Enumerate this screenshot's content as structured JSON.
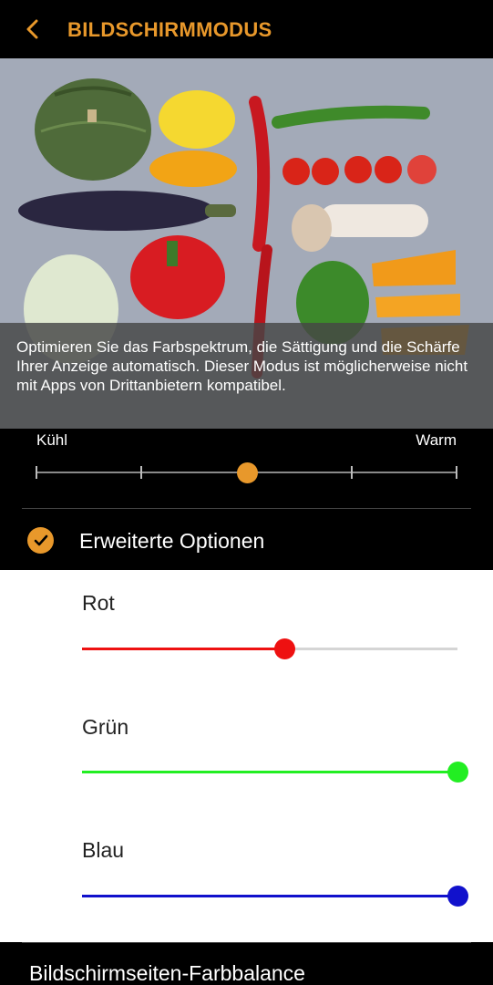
{
  "header": {
    "title": "BILDSCHIRMMODUS",
    "back_icon": "chevron-left-icon",
    "accent_color": "#e8982b"
  },
  "preview": {
    "caption": "Optimieren Sie das Farbspektrum, die Sättigung und die Schärfe Ihrer Anzeige automatisch. Dieser Modus ist möglicherweise nicht mit Apps von Drittanbietern kompatibel."
  },
  "color_temperature": {
    "left_label": "Kühl",
    "right_label": "Warm",
    "steps": 5,
    "value_step": 2
  },
  "advanced": {
    "label": "Erweiterte Optionen",
    "checked": true
  },
  "rgb": [
    {
      "label": "Rot",
      "value": 0.54,
      "color": "#ee1111"
    },
    {
      "label": "Grün",
      "value": 1.0,
      "color": "#22ee22"
    },
    {
      "label": "Blau",
      "value": 1.0,
      "color": "#1111cc"
    }
  ],
  "edge_balance": {
    "label": "Bildschirmseiten-Farbbalance"
  }
}
